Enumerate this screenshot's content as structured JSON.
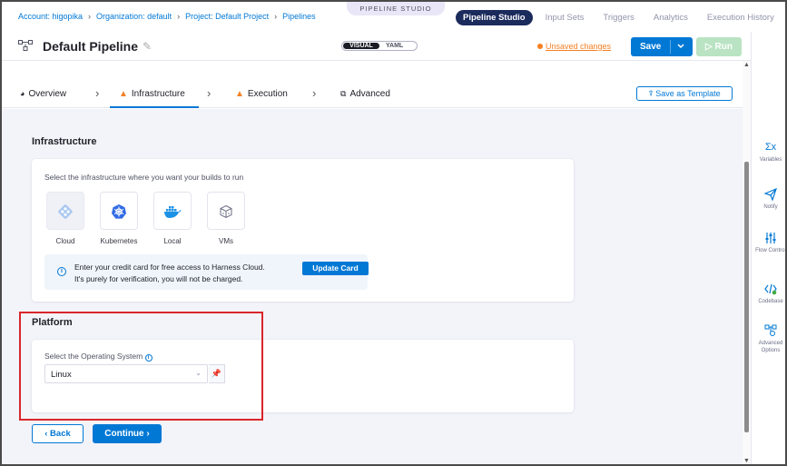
{
  "breadcrumbs": [
    "Account: higopika",
    "Organization: default",
    "Project: Default Project",
    "Pipelines"
  ],
  "studio_label": "PIPELINE STUDIO",
  "top_tabs": [
    {
      "label": "Pipeline Studio",
      "active": true
    },
    {
      "label": "Input Sets",
      "active": false
    },
    {
      "label": "Triggers",
      "active": false
    },
    {
      "label": "Analytics",
      "active": false
    },
    {
      "label": "Execution History",
      "active": false
    }
  ],
  "header": {
    "title": "Default Pipeline",
    "view_toggle": {
      "visual": "VISUAL",
      "yaml": "YAML"
    },
    "unsaved": "Unsaved changes",
    "save_label": "Save",
    "run_label": "Run"
  },
  "steps": [
    {
      "label": "Overview",
      "warning": false,
      "active": false
    },
    {
      "label": "Infrastructure",
      "warning": true,
      "active": true
    },
    {
      "label": "Execution",
      "warning": true,
      "active": false
    },
    {
      "label": "Advanced",
      "warning": false,
      "active": false
    }
  ],
  "save_template_label": "Save as Template",
  "infrastructure": {
    "title": "Infrastructure",
    "subtitle": "Select the infrastructure where you want your builds to run",
    "options": [
      {
        "label": "Cloud",
        "icon": "cloud-icon",
        "selected": true
      },
      {
        "label": "Kubernetes",
        "icon": "kubernetes-icon",
        "selected": false
      },
      {
        "label": "Local",
        "icon": "docker-icon",
        "selected": false
      },
      {
        "label": "VMs",
        "icon": "vm-icon",
        "selected": false
      }
    ],
    "banner_line1": "Enter your credit card for free access to Harness Cloud.",
    "banner_line2": "It's purely for verification, you will not be charged.",
    "update_card_label": "Update Card"
  },
  "platform": {
    "title": "Platform",
    "os_label": "Select the Operating System",
    "os_value": "Linux"
  },
  "footer": {
    "back_label": "Back",
    "continue_label": "Continue"
  },
  "right_panel": [
    {
      "label": "Variables",
      "icon": "variables-icon"
    },
    {
      "label": "Notify",
      "icon": "notify-icon"
    },
    {
      "label": "Flow Control",
      "icon": "flow-control-icon"
    },
    {
      "label": "Codebase",
      "icon": "codebase-icon"
    },
    {
      "label": "Advanced Options",
      "icon": "advanced-options-icon"
    }
  ],
  "colors": {
    "primary": "#0278d5",
    "warning": "#f48024",
    "highlight_box": "#d9262b",
    "nav_active": "#1b2b5c"
  }
}
